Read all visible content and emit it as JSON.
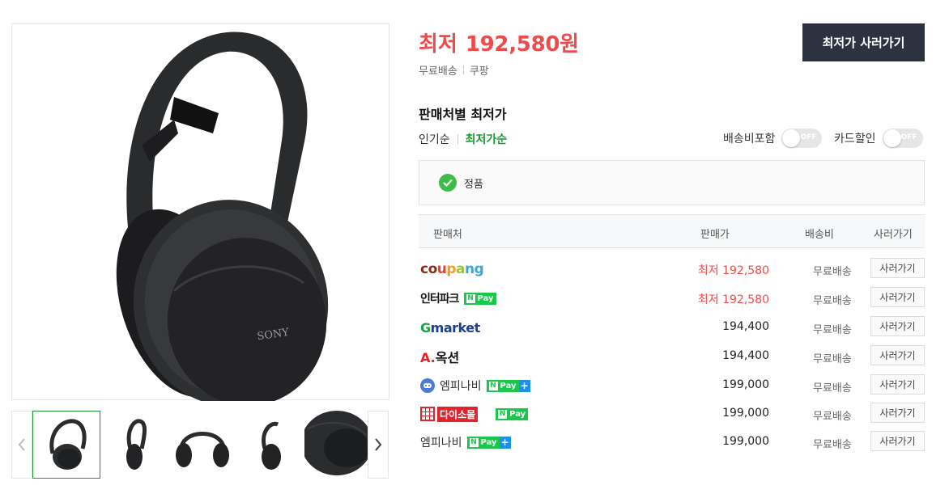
{
  "header": {
    "price_prefix": "최저",
    "price_value": "192,580원",
    "shipping": "무료배송",
    "mall": "쿠팡",
    "buy_button": "최저가 사러가기"
  },
  "sellers_section": {
    "title": "판매처별 최저가",
    "sort_options": [
      {
        "label": "인기순",
        "active": false
      },
      {
        "label": "최저가순",
        "active": true
      }
    ],
    "toggles": [
      {
        "label": "배송비포함",
        "state": "OFF"
      },
      {
        "label": "카드할인",
        "state": "OFF"
      }
    ],
    "genuine_label": "정품"
  },
  "table": {
    "headers": {
      "seller": "판매처",
      "price": "판매가",
      "shipping": "배송비",
      "buy": "사러가기"
    },
    "rows": [
      {
        "seller": "coupang",
        "seller_display": "coupang",
        "npay": false,
        "price": "최저 192,580",
        "lowest": true,
        "shipping": "무료배송",
        "buy": "사러가기"
      },
      {
        "seller": "interpark",
        "seller_display": "인터파크",
        "npay": true,
        "price": "최저 192,580",
        "lowest": true,
        "shipping": "무료배송",
        "buy": "사러가기"
      },
      {
        "seller": "gmarket",
        "seller_display": "market",
        "npay": false,
        "price": "194,400",
        "lowest": false,
        "shipping": "무료배송",
        "buy": "사러가기"
      },
      {
        "seller": "auction",
        "seller_display": "옥션",
        "npay": false,
        "price": "194,400",
        "lowest": false,
        "shipping": "무료배송",
        "buy": "사러가기"
      },
      {
        "seller": "mpnavi-logo",
        "seller_display": "엠피나비",
        "npay": true,
        "npay_plus": true,
        "price": "199,000",
        "lowest": false,
        "shipping": "무료배송",
        "buy": "사러가기"
      },
      {
        "seller": "daiso",
        "seller_display": "다이소몰",
        "npay": true,
        "price": "199,000",
        "lowest": false,
        "shipping": "무료배송",
        "buy": "사러가기"
      },
      {
        "seller": "mpnavi-text",
        "seller_display": "엠피나비",
        "npay": true,
        "npay_plus": true,
        "price": "199,000",
        "lowest": false,
        "shipping": "무료배송",
        "buy": "사러가기"
      }
    ]
  },
  "npay": {
    "n": "N",
    "label": "Pay",
    "plus": "+"
  },
  "product_image": {
    "brand_mark": "SONY"
  },
  "colors": {
    "price_red": "#f04a4a",
    "accent_green": "#1a9a2f",
    "dark_button": "#2d3240",
    "npay_green": "#19c84b"
  },
  "icons": [
    "chevron-left-icon",
    "chevron-right-icon",
    "check-icon",
    "mpnavi-icon",
    "daiso-icon"
  ]
}
